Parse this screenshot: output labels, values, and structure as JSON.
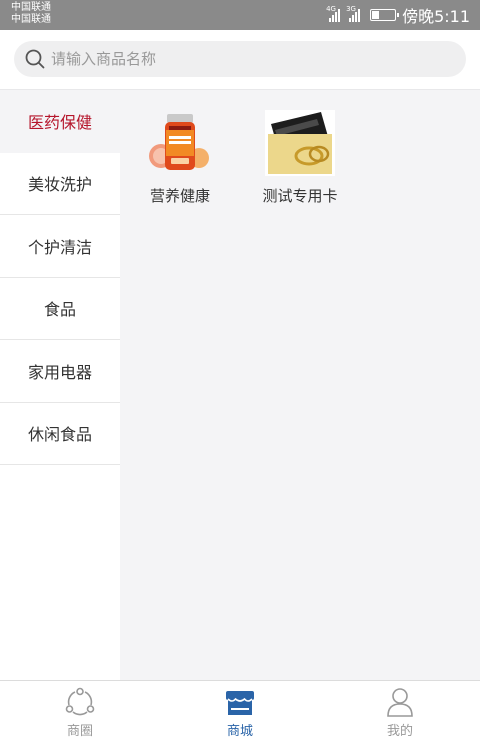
{
  "status_bar": {
    "carrier_1": "中国联通",
    "carrier_2": "中国联通",
    "signal_1_tag": "4G",
    "signal_2_tag": "3G",
    "time": "傍晚5:11"
  },
  "search": {
    "placeholder": "请输入商品名称"
  },
  "categories": [
    {
      "label": "医药保健",
      "active": true
    },
    {
      "label": "美妆洗护",
      "active": false
    },
    {
      "label": "个护清洁",
      "active": false
    },
    {
      "label": "食品",
      "active": false
    },
    {
      "label": "家用电器",
      "active": false
    },
    {
      "label": "休闲食品",
      "active": false
    }
  ],
  "products": [
    {
      "name": "营养健康",
      "icon": "supplement-bottle-image"
    },
    {
      "name": "测试专用卡",
      "icon": "gift-card-image"
    }
  ],
  "tabs": [
    {
      "label": "商圈",
      "icon": "circle-nodes-icon",
      "active": false
    },
    {
      "label": "商城",
      "icon": "store-icon",
      "active": true
    },
    {
      "label": "我的",
      "icon": "user-icon",
      "active": false
    }
  ],
  "colors": {
    "status_bar_bg": "#8a8a8a",
    "active_category": "#b5152b",
    "active_tab": "#2a64a8",
    "content_bg": "#f4f4f6"
  }
}
